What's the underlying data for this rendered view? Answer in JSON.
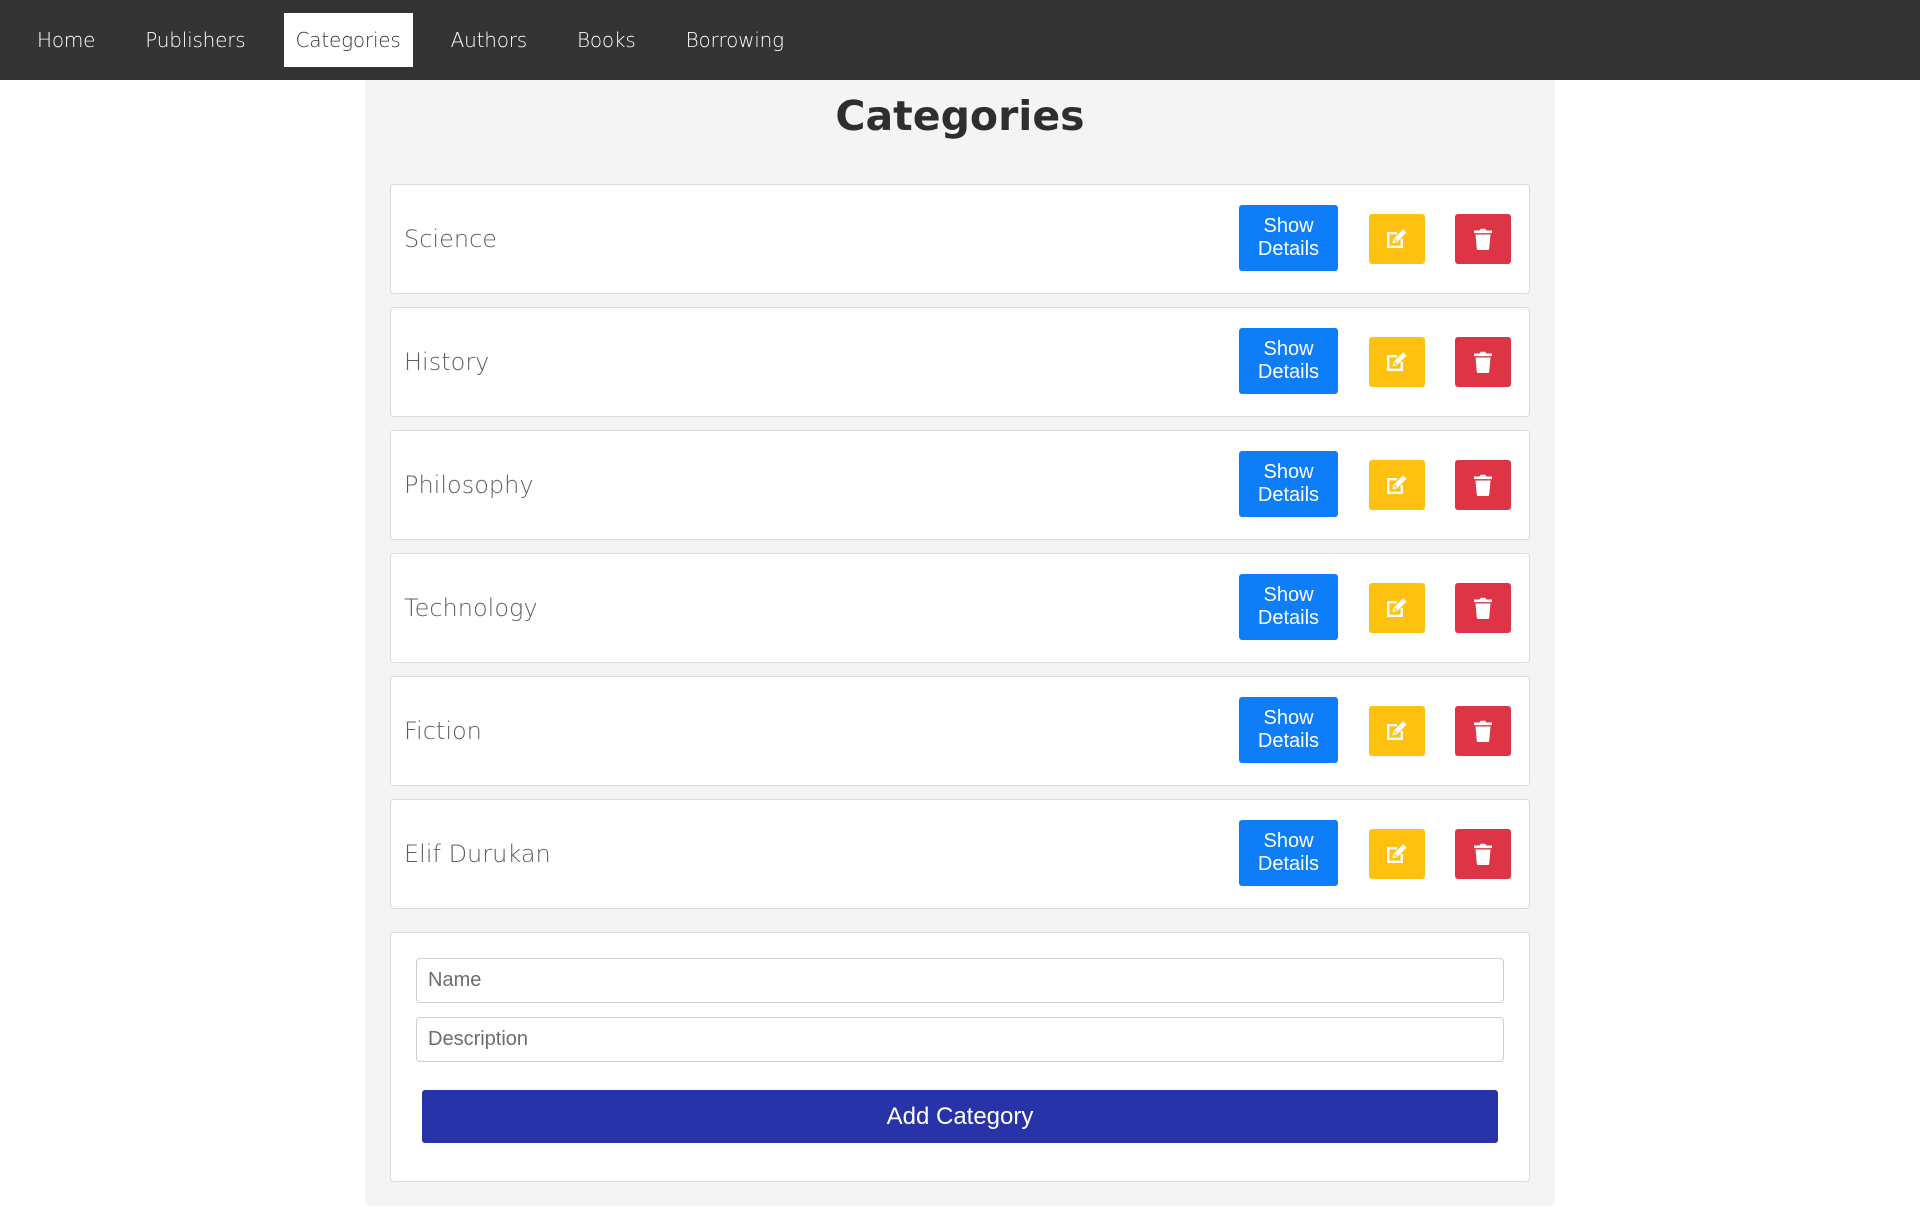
{
  "nav": {
    "items": [
      {
        "label": "Home",
        "active": false
      },
      {
        "label": "Publishers",
        "active": false
      },
      {
        "label": "Categories",
        "active": true
      },
      {
        "label": "Authors",
        "active": false
      },
      {
        "label": "Books",
        "active": false
      },
      {
        "label": "Borrowing",
        "active": false
      }
    ]
  },
  "page": {
    "title": "Categories"
  },
  "categories": [
    {
      "name": "Science",
      "details_label": "Show Details"
    },
    {
      "name": "History",
      "details_label": "Show Details"
    },
    {
      "name": "Philosophy",
      "details_label": "Show Details"
    },
    {
      "name": "Technology",
      "details_label": "Show Details"
    },
    {
      "name": "Fiction",
      "details_label": "Show Details"
    },
    {
      "name": "Elif Durukan",
      "details_label": "Show Details"
    }
  ],
  "icons": {
    "edit": "edit-icon",
    "delete": "trash-icon"
  },
  "form": {
    "name_placeholder": "Name",
    "name_value": "",
    "description_placeholder": "Description",
    "description_value": "",
    "submit_label": "Add Category"
  },
  "colors": {
    "navbar": "#343434",
    "primary": "#0d7ef8",
    "warning": "#fec10f",
    "danger": "#dd3545",
    "submit": "#2833a9"
  }
}
